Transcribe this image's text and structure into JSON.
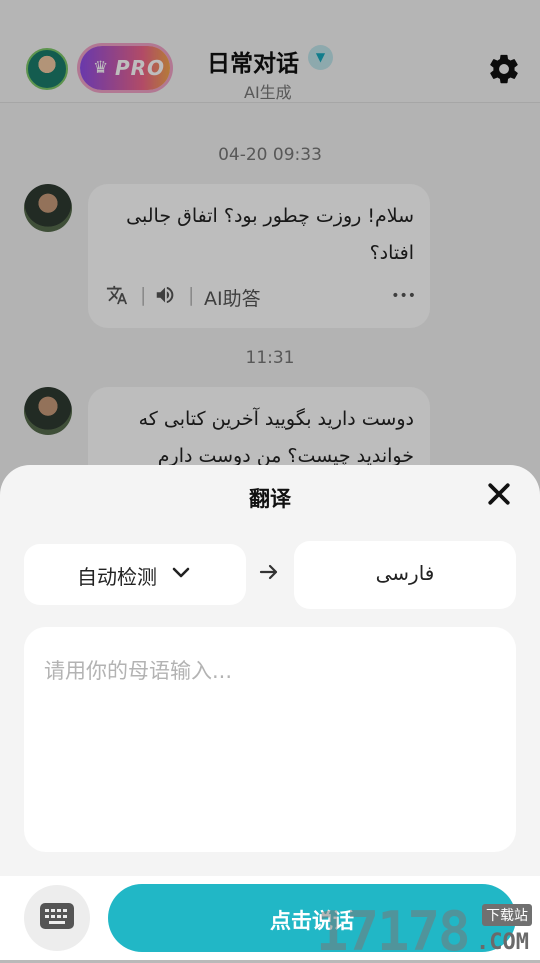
{
  "header": {
    "pro_label": "PRO",
    "title": "日常对话",
    "subtitle": "AI生成"
  },
  "chat": {
    "timestamp1": "04-20 09:33",
    "message1": "سلام! روزت چطور بود؟ اتفاق جالبی افتاد؟",
    "tools": {
      "ai_help": "AI助答",
      "more": "•••"
    },
    "timestamp2": "11:31",
    "message2": "دوست دارید بگویید آخرین کتابی که خواندید چیست؟ من دوست دارم"
  },
  "translate_sheet": {
    "title": "翻译",
    "source_language": "自动检测",
    "target_language": "فارسی",
    "input_placeholder": "请用你的母语输入...",
    "input_value": ""
  },
  "bottom_bar": {
    "speak_label": "点击说话"
  },
  "watermark": {
    "number": "17178",
    "tag": "下载站",
    "domain": ".COM"
  },
  "colors": {
    "accent": "#21b7c6",
    "pro_gradient_start": "#8e4de8",
    "pro_gradient_end": "#f4a64d"
  }
}
